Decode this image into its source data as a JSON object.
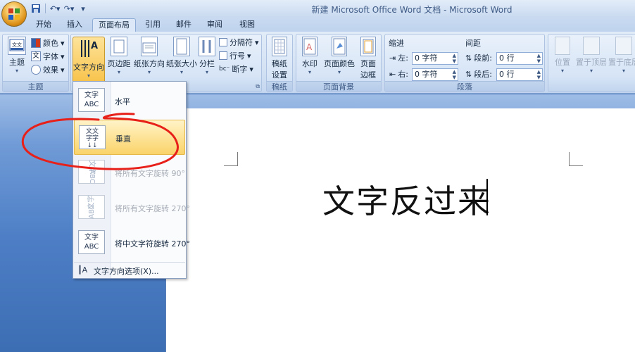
{
  "window": {
    "title": "新建 Microsoft Office Word 文档 - Microsoft Word"
  },
  "tabs": [
    "开始",
    "插入",
    "页面布局",
    "引用",
    "邮件",
    "审阅",
    "视图"
  ],
  "active_tab": "页面布局",
  "ribbon": {
    "theme_group": {
      "label": "主题",
      "theme_btn": "主题",
      "colors": "颜色",
      "fonts": "字体",
      "effects": "效果"
    },
    "page_setup_group": {
      "text_direction": "文字方向",
      "margins": "页边距",
      "orientation": "纸张方向",
      "size": "纸张大小",
      "columns": "分栏",
      "breaks": "分隔符",
      "line_numbers": "行号",
      "hyphenation": "断字"
    },
    "manuscript_group": {
      "label": "稿纸",
      "btn": "稿纸\n设置",
      "btn_line1": "稿纸",
      "btn_line2": "设置"
    },
    "background_group": {
      "label": "页面背景",
      "watermark": "水印",
      "page_color": "页面颜色",
      "border_line1": "页面",
      "border_line2": "边框"
    },
    "paragraph_group": {
      "label": "段落",
      "indent_header": "缩进",
      "spacing_header": "间距",
      "left_label": "左:",
      "right_label": "右:",
      "left_value": "0 字符",
      "right_value": "0 字符",
      "before_label": "段前:",
      "after_label": "段后:",
      "before_value": "0 行",
      "after_value": "0 行"
    },
    "arrange_group": {
      "position": "位置",
      "bring_front": "置于顶层",
      "send_back": "置于底层"
    }
  },
  "dropdown": {
    "items": [
      {
        "label": "水平",
        "icon_text": "文字\nABC"
      },
      {
        "label": "垂直"
      },
      {
        "label": "将所有文字旋转 90°"
      },
      {
        "label": "将所有文字旋转 270°"
      },
      {
        "label": "将中文字符旋转 270°"
      }
    ],
    "footer": "文字方向选项(X)..."
  },
  "document": {
    "text": "文字反过来"
  },
  "colors": {
    "annotation": "#e8201a",
    "highlight": "#fad36a",
    "ribbon": "#d4e2f4",
    "workspace": "#4e7fc6"
  }
}
